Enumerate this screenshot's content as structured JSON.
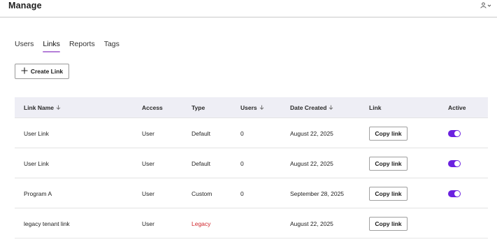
{
  "header": {
    "title": "Manage",
    "user_icon": "user-icon",
    "dropdown_icon": "chevron-down-icon"
  },
  "tabs": [
    {
      "label": "Users",
      "active": false
    },
    {
      "label": "Links",
      "active": true
    },
    {
      "label": "Reports",
      "active": false
    },
    {
      "label": "Tags",
      "active": false
    }
  ],
  "toolbar": {
    "create_label": "Create Link",
    "create_icon": "plus-icon"
  },
  "table": {
    "columns": [
      {
        "label": "Link Name",
        "sortable": true
      },
      {
        "label": "Access",
        "sortable": false
      },
      {
        "label": "Type",
        "sortable": false
      },
      {
        "label": "Users",
        "sortable": true
      },
      {
        "label": "Date Created",
        "sortable": true
      },
      {
        "label": "Link",
        "sortable": false
      },
      {
        "label": "Active",
        "sortable": false
      }
    ],
    "rows": [
      {
        "name": "User Link",
        "access": "User",
        "type": "Default",
        "users": "0",
        "date": "August 22, 2025",
        "link_label": "Copy link",
        "active": true
      },
      {
        "name": "User Link",
        "access": "User",
        "type": "Default",
        "users": "0",
        "date": "August 22, 2025",
        "link_label": "Copy link",
        "active": true
      },
      {
        "name": "Program A",
        "access": "User",
        "type": "Custom",
        "users": "0",
        "date": "September 28, 2025",
        "link_label": "Copy link",
        "active": true
      },
      {
        "name": "legacy tenant link",
        "access": "User",
        "type": "Legacy",
        "users": "",
        "date": "August 22, 2025",
        "link_label": "Copy link",
        "active": false
      }
    ]
  },
  "colors": {
    "accent": "#6b21e0",
    "tab_underline": "#b57fd8",
    "header_bg": "#eeeef5",
    "legacy_text": "#d0262c"
  }
}
